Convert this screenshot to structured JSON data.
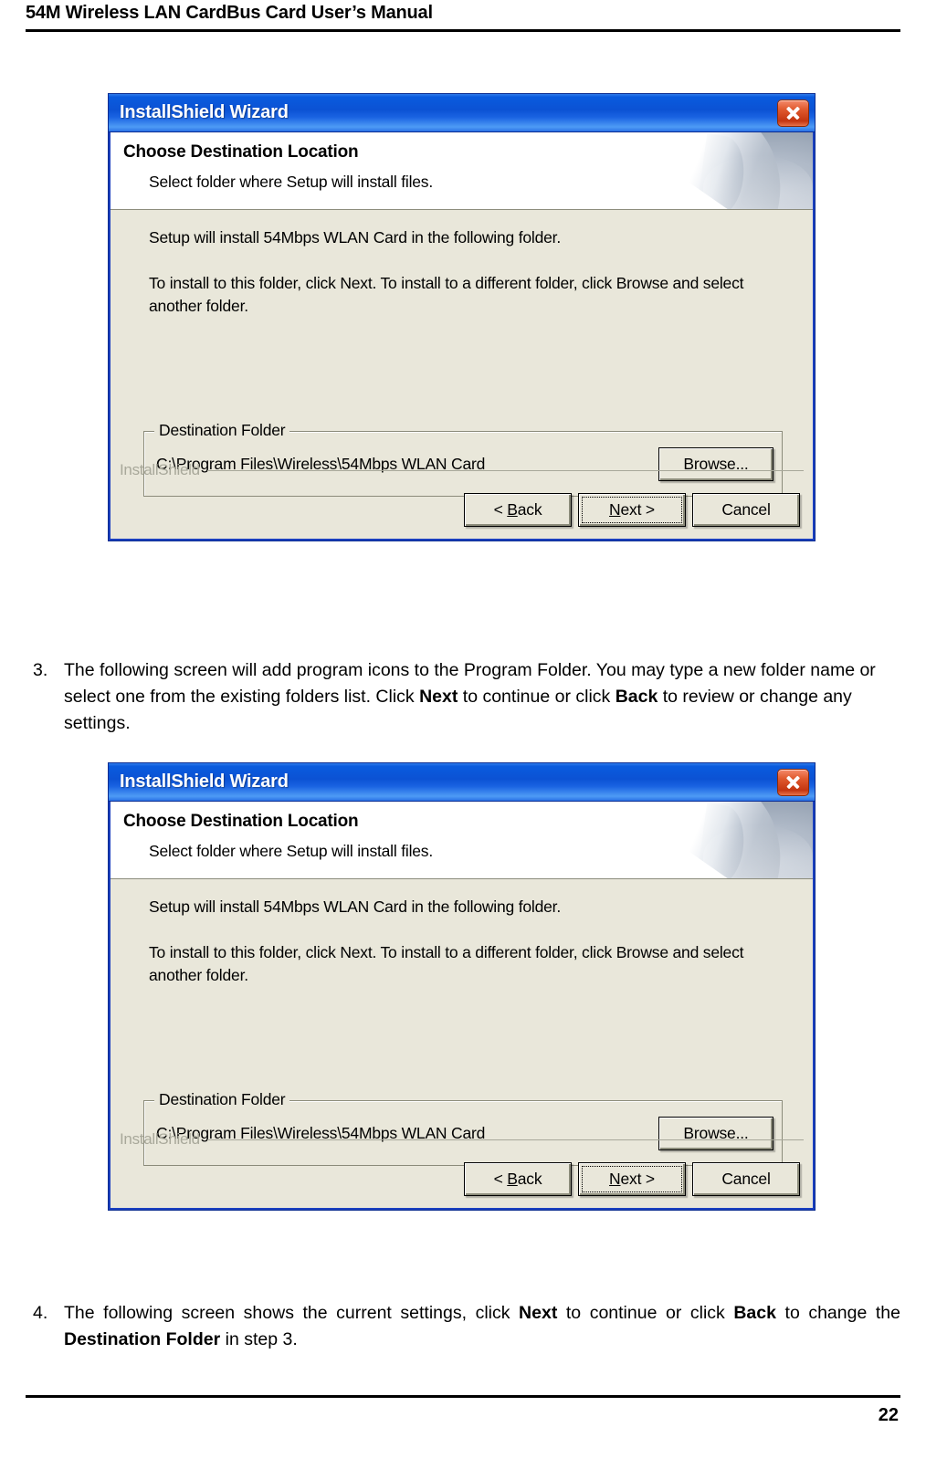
{
  "page": {
    "header_title": "54M Wireless LAN CardBus Card User’s Manual",
    "page_number": "22"
  },
  "dialog": {
    "title": "InstallShield Wizard",
    "close_icon": "close-icon",
    "banner": {
      "heading": "Choose Destination Location",
      "subheading": "Select folder where Setup will install files.",
      "art": "curled-paper-graphic"
    },
    "body": {
      "paragraph1": "Setup will install 54Mbps WLAN Card in the following folder.",
      "paragraph2": "To install to this folder, click Next. To install to a different folder, click Browse and select another folder."
    },
    "group": {
      "legend": "Destination Folder",
      "path": "C:\\Program Files\\Wireless\\54Mbps WLAN Card",
      "browse_label": "Browse..."
    },
    "brand": "InstallShield",
    "buttons": {
      "back": "< Back",
      "next": "Next >",
      "cancel": "Cancel"
    }
  },
  "steps": [
    {
      "number": "3.",
      "text_parts": [
        {
          "t": "The following screen will add program icons to the Program Folder. You may type a new folder name or select one from the existing folders list. Click ",
          "b": false
        },
        {
          "t": "Next",
          "b": true
        },
        {
          "t": " to continue or click ",
          "b": false
        },
        {
          "t": "Back",
          "b": true
        },
        {
          "t": " to review or change any settings.",
          "b": false
        }
      ]
    },
    {
      "number": "4.",
      "text_parts": [
        {
          "t": "The following screen shows the current settings, click ",
          "b": false
        },
        {
          "t": "Next",
          "b": true
        },
        {
          "t": " to continue or click ",
          "b": false
        },
        {
          "t": "Back",
          "b": true
        },
        {
          "t": " to change the ",
          "b": false
        },
        {
          "t": "Destination Folder",
          "b": true
        },
        {
          "t": " in step 3.",
          "b": false
        }
      ]
    }
  ],
  "colors": {
    "titlebar_blue": "#0B52D4",
    "dialog_border": "#1A3FBF",
    "dialog_bg": "#E9E7DA",
    "close_red": "#C43510",
    "brand_gray": "#A8A89A"
  }
}
